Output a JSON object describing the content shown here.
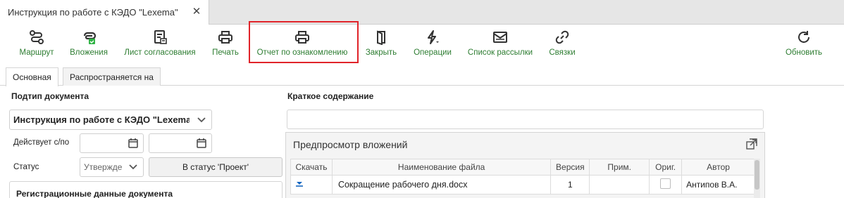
{
  "doc_tab": {
    "title": "Инструкция по работе с КЭДО \"Lexema\"",
    "close": "✕"
  },
  "toolbar": {
    "route": "Маршрут",
    "attachments": "Вложения",
    "approval_sheet": "Лист согласования",
    "print": "Печать",
    "acquaintance_report": "Отчет по ознакомлению",
    "close": "Закрыть",
    "operations": "Операции",
    "mailing_list": "Список рассылки",
    "links": "Связки",
    "refresh": "Обновить"
  },
  "tabs": {
    "main": "Основная",
    "spreads_to": "Распространяется на"
  },
  "form": {
    "subtype_label": "Подтип документа",
    "subtype_value": "Инструкция по работе с КЭДО \"Lexema\"",
    "valid_label": "Действует с/по",
    "status_label": "Статус",
    "status_value": "Утвержден",
    "to_project_button": "В статус 'Проект'",
    "reg_data_label": "Регистрационные данные документа",
    "summary_label": "Краткое содержание"
  },
  "preview": {
    "title": "Предпросмотр вложений",
    "columns": [
      "Скачать",
      "Наименование файла",
      "Версия",
      "Прим.",
      "Ориг.",
      "Автор"
    ],
    "rows": [
      {
        "file": "Сокращение рабочего дня.docx",
        "version": "1",
        "note": "",
        "author": "Антипов В.А."
      }
    ]
  },
  "colors": {
    "accent_green": "#2e7d32",
    "highlight_red": "#e0242a"
  }
}
